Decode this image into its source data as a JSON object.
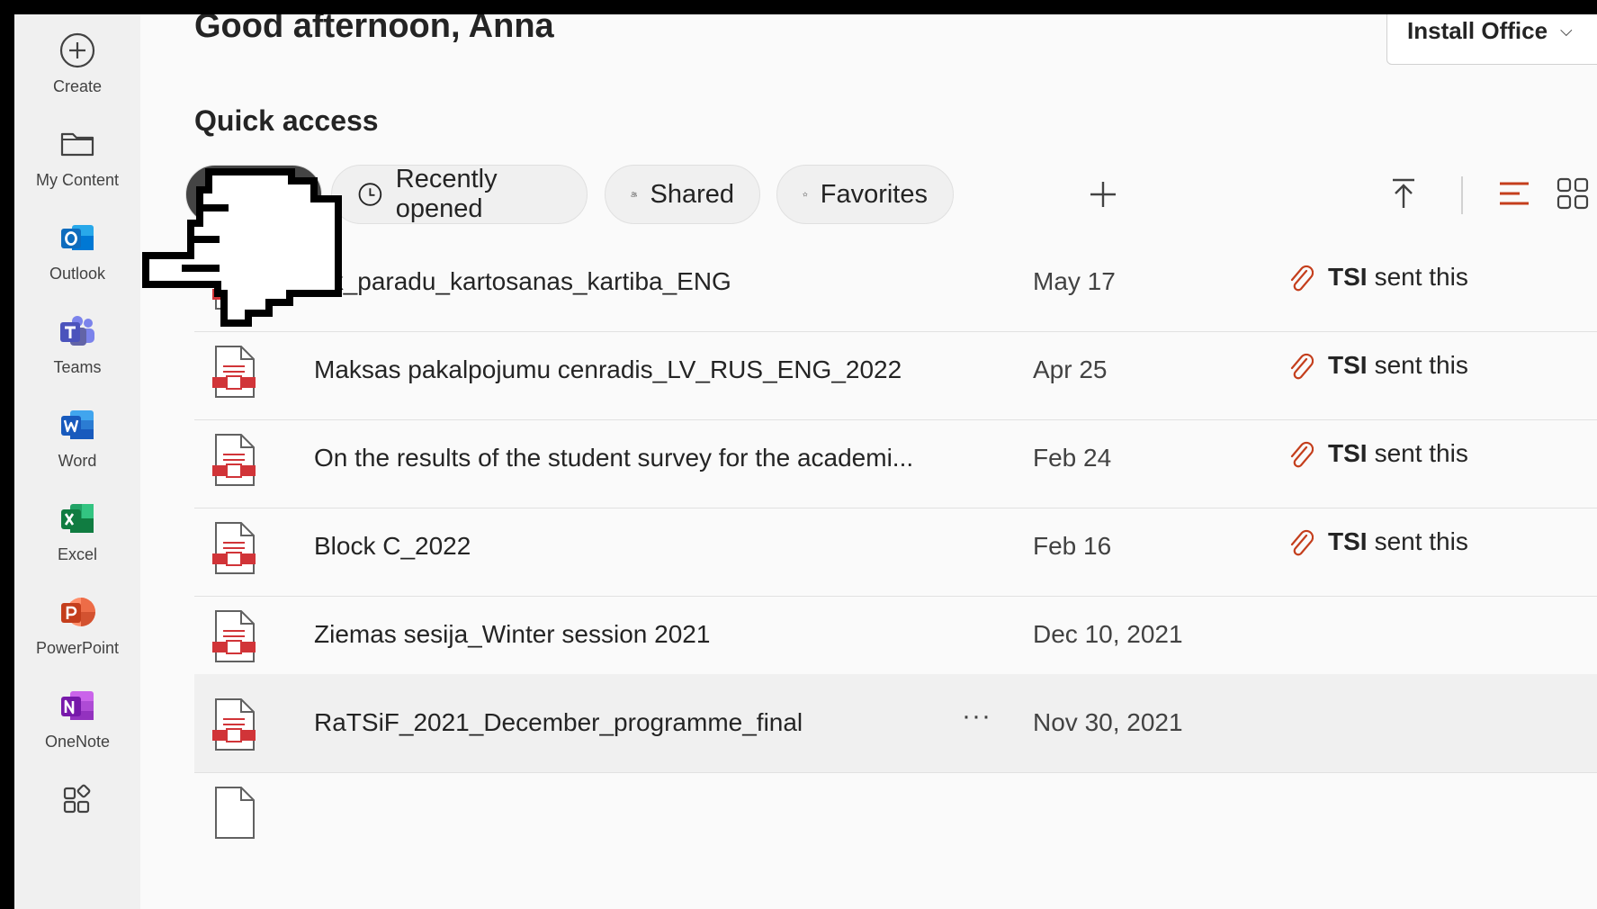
{
  "rail": {
    "items": [
      {
        "label": "Create",
        "icon": "plus-circle-icon"
      },
      {
        "label": "My Content",
        "icon": "folder-icon"
      },
      {
        "label": "Outlook",
        "icon": "outlook-icon"
      },
      {
        "label": "Teams",
        "icon": "teams-icon"
      },
      {
        "label": "Word",
        "icon": "word-icon"
      },
      {
        "label": "Excel",
        "icon": "excel-icon"
      },
      {
        "label": "PowerPoint",
        "icon": "powerpoint-icon"
      },
      {
        "label": "OneNote",
        "icon": "onenote-icon"
      }
    ]
  },
  "header": {
    "greeting": "Good afternoon, Anna",
    "install_label": "Install Office"
  },
  "quick_access": {
    "title": "Quick access",
    "filters": [
      {
        "label": "Recently opened",
        "icon": "clock-icon"
      },
      {
        "label": "Shared",
        "icon": "people-icon"
      },
      {
        "label": "Favorites",
        "icon": "star-icon"
      }
    ]
  },
  "files": [
    {
      "name": "Ak_paradu_kartosanas_kartiba_ENG",
      "date": "May 17",
      "activity_who": "TSI",
      "activity_text": "sent this"
    },
    {
      "name": "Maksas pakalpojumu cenradis_LV_RUS_ENG_2022",
      "date": "Apr 25",
      "activity_who": "TSI",
      "activity_text": "sent this"
    },
    {
      "name": "On the results of the student survey for the academi...",
      "date": "Feb 24",
      "activity_who": "TSI",
      "activity_text": "sent this"
    },
    {
      "name": "Block C_2022",
      "date": "Feb 16",
      "activity_who": "TSI",
      "activity_text": "sent this"
    },
    {
      "name": "Ziemas sesija_Winter session 2021",
      "date": "Dec 10, 2021"
    },
    {
      "name": "RaTSiF_2021_December_programme_final",
      "date": "Nov 30, 2021",
      "more": "···"
    }
  ],
  "colors": {
    "pdf_red": "#d13438",
    "accent_orange": "#c43e1c",
    "outlook_blue": "#0f6cbd",
    "teams_purple": "#5b5fc7",
    "word_blue": "#185abd",
    "excel_green": "#107c41",
    "ppt_orange": "#c43e1c",
    "onenote_purple": "#7719aa"
  }
}
